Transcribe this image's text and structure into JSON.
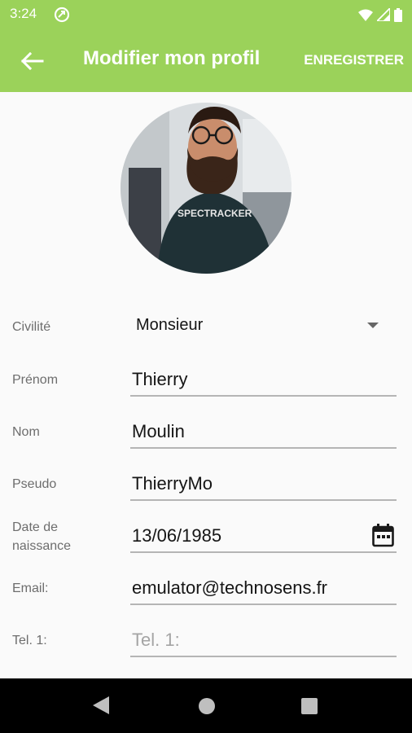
{
  "status_bar": {
    "time": "3:24",
    "icons": [
      "sync-icon",
      "wifi-icon",
      "signal-icon",
      "battery-icon"
    ]
  },
  "app_bar": {
    "title": "Modifier mon profil",
    "save_label": "ENREGISTRER",
    "back_icon": "arrow-left-icon",
    "color": "#9bd25a"
  },
  "profile": {
    "avatar_icon": "profile-photo"
  },
  "form": {
    "civilite": {
      "label": "Civilité",
      "value": "Monsieur"
    },
    "prenom": {
      "label": "Prénom",
      "value": "Thierry"
    },
    "nom": {
      "label": "Nom",
      "value": "Moulin"
    },
    "pseudo": {
      "label": "Pseudo",
      "value": "ThierryMo"
    },
    "date_naissance": {
      "label_line1": "Date de",
      "label_line2": "naissance",
      "value": "13/06/1985",
      "icon": "calendar-icon"
    },
    "email": {
      "label": "Email:",
      "value": "emulator@technosens.fr"
    },
    "tel1": {
      "label": "Tel. 1:",
      "value": "",
      "placeholder": "Tel. 1:"
    }
  },
  "nav_bar": {
    "icons": [
      "nav-back-icon",
      "nav-home-icon",
      "nav-recents-icon"
    ]
  }
}
